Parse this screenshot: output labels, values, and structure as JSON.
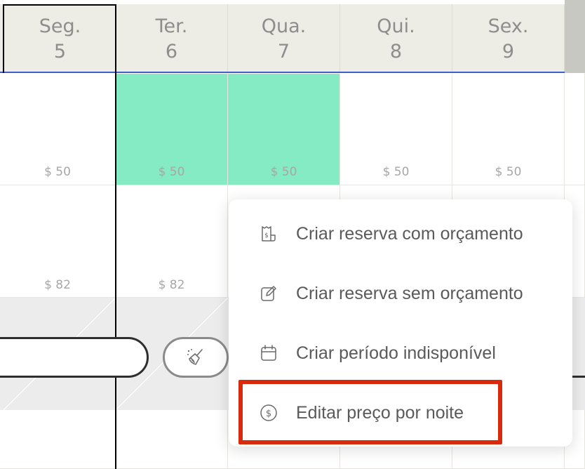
{
  "days": [
    {
      "weekday": "Seg.",
      "date": "5"
    },
    {
      "weekday": "Ter.",
      "date": "6"
    },
    {
      "weekday": "Qua.",
      "date": "7"
    },
    {
      "weekday": "Qui.",
      "date": "8"
    },
    {
      "weekday": "Sex.",
      "date": "9"
    }
  ],
  "row1_prices": [
    "$ 50",
    "$ 50",
    "$ 50",
    "$ 50",
    "$ 50"
  ],
  "row2_prices": [
    "$ 82",
    "$ 82"
  ],
  "menu": {
    "items": [
      {
        "label": "Criar reserva com orçamento",
        "icon": "receipt-dollar-icon"
      },
      {
        "label": "Criar reserva sem orçamento",
        "icon": "edit-icon"
      },
      {
        "label": "Criar período indisponível",
        "icon": "calendar-icon"
      },
      {
        "label": "Editar preço por noite",
        "icon": "dollar-circle-icon"
      }
    ]
  },
  "colors": {
    "selected": "#84ebc5",
    "highlight": "#d82a0c",
    "header_bg": "#edede5"
  },
  "tools": {
    "clean_icon": "broom-icon"
  }
}
